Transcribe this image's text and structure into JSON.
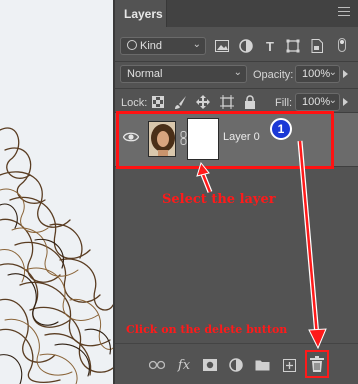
{
  "panel": {
    "title": "Layers",
    "filter": {
      "value": "Kind"
    },
    "blend_mode": "Normal",
    "opacity": {
      "label": "Opacity:",
      "value": "100%"
    },
    "lock_label": "Lock:",
    "fill": {
      "label": "Fill:",
      "value": "100%"
    },
    "layer": {
      "name": "Layer 0"
    }
  },
  "annotations": {
    "step_number": "1",
    "select_note": "Select the layer",
    "delete_note": "Click on the delete button"
  },
  "colors": {
    "annotation_red": "#ff1212",
    "badge_blue": "#1a38d6",
    "panel_bg": "#535353",
    "layer_selected_bg": "#6b6b6b"
  }
}
